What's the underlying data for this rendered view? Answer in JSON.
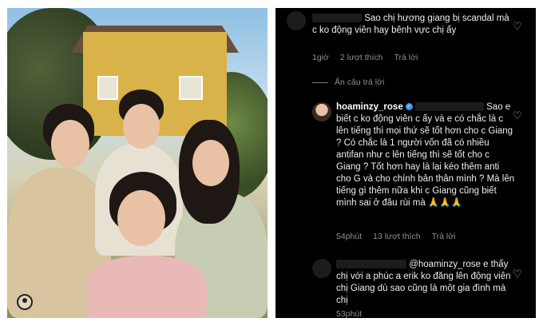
{
  "photo": {
    "alt": "Group photo of five people posing in front of a house",
    "icons": {
      "avatar": "user-avatar-icon"
    }
  },
  "comments": [
    {
      "id": "c1",
      "text": "Sao chị hương giang bị scandal mà c ko động viên hay bênh vực chị ấy",
      "time": "1giờ",
      "likes": "2 lượt thích",
      "reply": "Trả lời"
    },
    {
      "id": "c2",
      "username": "hoaminzy_rose",
      "text": "Sao e biết c ko động viên c ấy và e có chắc là c lên tiếng thì mọi thứ sẽ tốt hơn cho c Giang ? Có chắc là 1 người vốn đã có nhiều antifan như c lên tiếng thì sẽ tốt cho c Giang ? Tốt hơn hay là lại kéo thêm anti cho G và cho chính bản thân mình ? Mà lên tiếng gì thêm nữa khi c Giang cũng biết mình sai ở đâu rùi mà 🙏🙏🙏",
      "time": "54phút",
      "likes": "13 lượt thích",
      "reply": "Trả lời"
    },
    {
      "id": "c3",
      "mention": "@hoaminzy_rose",
      "text": "e thấy chị với a phúc a erik ko đăng lên động viên chị Giang dù sao cũng là một gia đình mà chị",
      "time": "53phút",
      "likes": "",
      "reply": ""
    }
  ],
  "hide_replies": "Ẩn câu trả lời",
  "colors": {
    "panel_bg": "#000000",
    "meta": "#8e8e8e",
    "verified": "#3897f0"
  }
}
